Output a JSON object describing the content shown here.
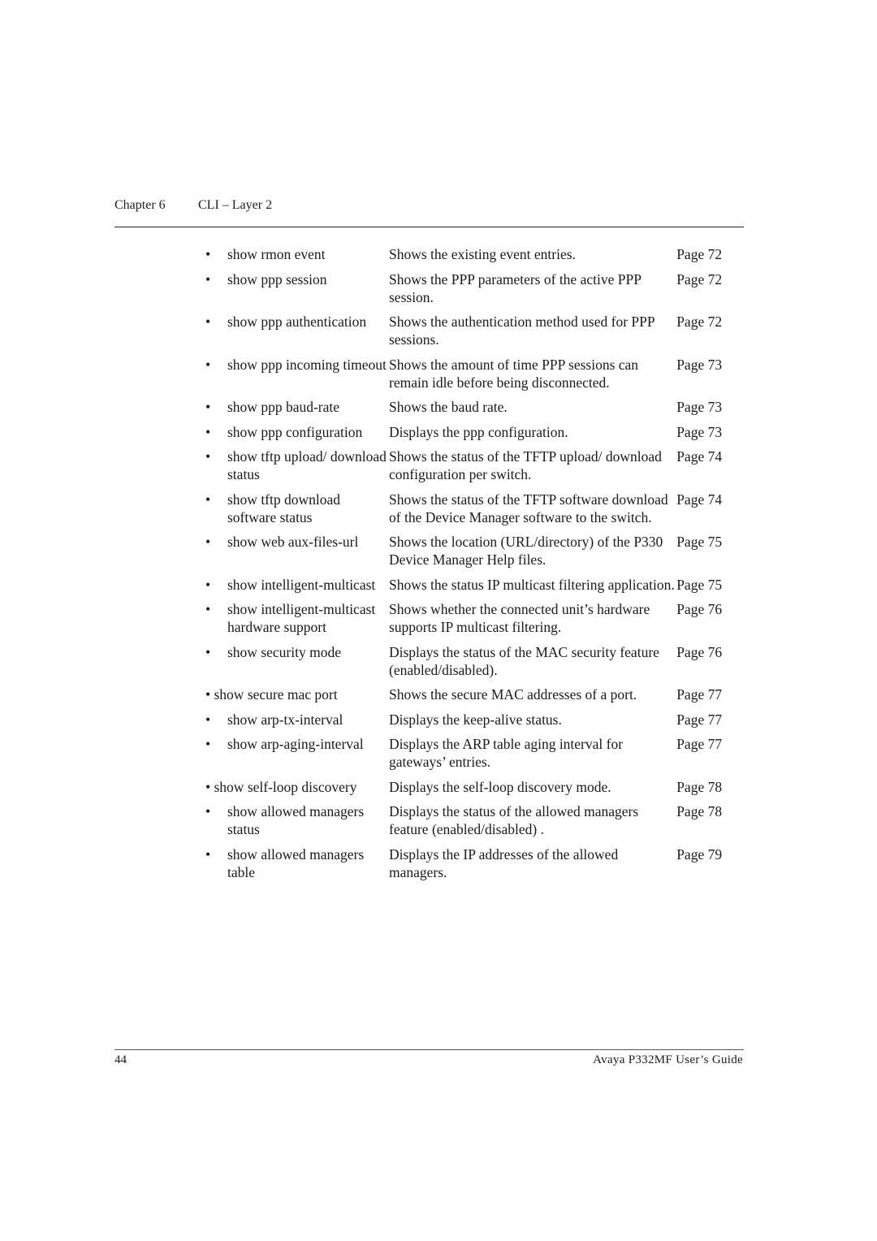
{
  "header": {
    "chapter": "Chapter 6",
    "title": "CLI – Layer 2"
  },
  "bullet_glyph": "•",
  "rows": [
    {
      "command": "show rmon event",
      "description": "Shows the existing event entries.",
      "page": "Page 72"
    },
    {
      "command": "show ppp session",
      "description": "Shows the PPP parameters of the active PPP session.",
      "page": "Page 72"
    },
    {
      "command": "show ppp authentication",
      "description": "Shows the authentication method used for PPP sessions.",
      "page": "Page 72"
    },
    {
      "command": "show ppp incoming timeout",
      "description": "Shows the amount of time PPP sessions can remain idle before being disconnected.",
      "page": "Page 73"
    },
    {
      "command": "show ppp baud-rate",
      "description": "Shows the baud rate.",
      "page": "Page 73"
    },
    {
      "command": "show ppp configuration",
      "description": "Displays the ppp configuration.",
      "page": "Page 73"
    },
    {
      "command": "show tftp upload/ download status",
      "description": "Shows the status of the TFTP upload/ download configuration per switch.",
      "page": "Page 74"
    },
    {
      "command": "show tftp download software status",
      "description": "Shows the status of the TFTP software download of the Device Manager software to the switch.",
      "page": "Page 74"
    },
    {
      "command": "show web aux-files-url",
      "description": "Shows the location (URL/directory) of the P330 Device Manager Help files.",
      "page": "Page 75"
    },
    {
      "command": "show intelligent-multicast",
      "description": "Shows the status IP multicast filtering application.",
      "page": "Page 75"
    },
    {
      "command": "show intelligent-multicast hardware support",
      "description": "Shows whether the connected unit’s hardware supports IP multicast filtering.",
      "page": "Page 76"
    },
    {
      "command": "show security mode",
      "description": "Displays the status of the MAC security feature (enabled/disabled).",
      "page": "Page 76"
    },
    {
      "command": "• show secure mac port",
      "description": "Shows the secure MAC addresses of a port.",
      "page": "Page 77",
      "inline_bullet": true
    },
    {
      "command": "show arp-tx-interval",
      "description": "Displays the keep-alive status.",
      "page": "Page 77"
    },
    {
      "command": "show arp-aging-interval",
      "description": "Displays the ARP table aging interval for gateways’ entries.",
      "page": "Page 77"
    },
    {
      "command": "• show self-loop discovery",
      "description": "Displays the self-loop discovery mode.",
      "page": "Page 78",
      "inline_bullet": true
    },
    {
      "command": "show allowed managers status",
      "description": "Displays the status of the allowed managers feature (enabled/disabled) .",
      "page": "Page 78"
    },
    {
      "command": "show allowed managers table",
      "description": "Displays the IP addresses of the allowed managers.",
      "page": "Page 79"
    }
  ],
  "footer": {
    "page_number": "44",
    "book_title": "Avaya P332MF User’s Guide"
  }
}
